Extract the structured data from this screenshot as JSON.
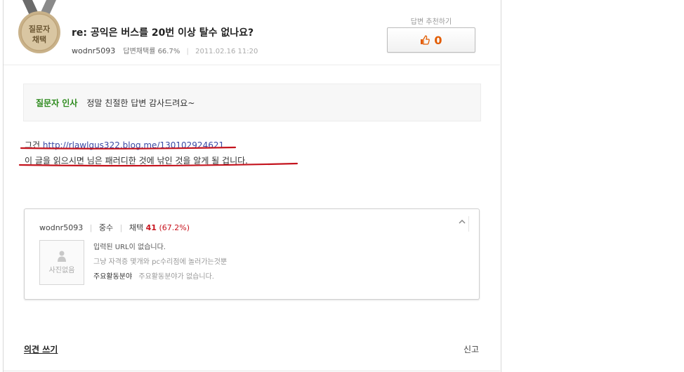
{
  "badge": {
    "line1": "질문자",
    "line2": "채택"
  },
  "post": {
    "title": "re: 공익은 버스를 20번 이상 탈수 없나요?",
    "author": "wodnr5093",
    "adoption_rate": "답변채택률 66.7%",
    "date": "2011.02.16 11:20"
  },
  "recommend": {
    "label": "답변 추천하기",
    "count": "0"
  },
  "greeting": {
    "label": "질문자 인사",
    "message": "정말 친절한 답변 감사드려요~"
  },
  "answer": {
    "line1_prefix": "그건",
    "link": "http://rlawlgus322.blog.me/130102924621",
    "line2": "이 글을 읽으시면 님은 패러디한 것에 낚인 것을 알게 될 겁니다."
  },
  "profile": {
    "username": "wodnr5093",
    "rank": "중수",
    "adopt_label": "채택",
    "adopt_count": "41",
    "adopt_pct": "(67.2%)",
    "photo_caption": "사진없음",
    "url_text": "입력된 URL이 없습니다.",
    "intro": "그냥 자격증 몇개와 pc수리점에 놀러가는것뿐",
    "activity_label": "주요활동분야",
    "activity_value": "주요활동분야가 없습니다."
  },
  "footer": {
    "comment": "의견 쓰기",
    "report": "신고"
  },
  "colors": {
    "accent_orange": "#e25b00",
    "greeting_green": "#2e8b1e",
    "adopt_red": "#c8141e",
    "link_blue": "#3a4aa5"
  }
}
